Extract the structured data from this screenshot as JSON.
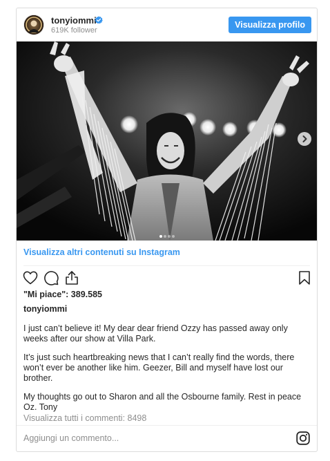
{
  "header": {
    "username": "tonyiommi",
    "followers": "619K follower",
    "profile_button": "Visualizza profilo",
    "avatar_icon": "avatar-icon",
    "verified_icon": "verified-badge-icon"
  },
  "media": {
    "carousel_dot_count": 4,
    "active_dot": 1,
    "next_icon": "chevron-right-icon"
  },
  "more_link": "Visualizza altri contenuti su Instagram",
  "actions": {
    "like_icon": "heart-icon",
    "comment_icon": "comment-icon",
    "share_icon": "share-icon",
    "save_icon": "bookmark-icon"
  },
  "likes": "\"Mi piace\": 389.585",
  "author": "tonyiommi",
  "caption": [
    "I just can’t believe it! My dear dear friend Ozzy has passed away only weeks after our show at Villa Park.",
    "It’s just such heartbreaking news that I can’t really find the words, there won’t ever be another like him. Geezer, Bill and myself have lost our brother.",
    "My thoughts go out to Sharon and all the Osbourne family. Rest in peace Oz. Tony"
  ],
  "comments_link": "Visualizza tutti i commenti: 8498",
  "add_comment_placeholder": "Aggiungi un commento...",
  "instagram_icon": "instagram-icon",
  "colors": {
    "accent": "#3897f0",
    "text": "#262626",
    "muted": "#8e8e8e",
    "border": "#dbdbdb"
  }
}
